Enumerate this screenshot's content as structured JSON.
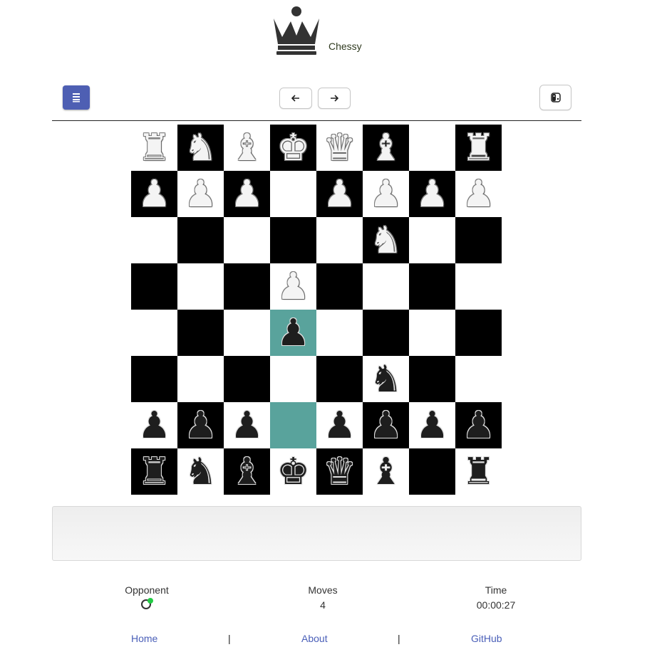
{
  "header": {
    "app_name": "Chessy",
    "logo_icon": "black-queen-icon"
  },
  "toolbar": {
    "menu_icon": "list-icon",
    "prev_icon": "arrow-left-icon",
    "next_icon": "arrow-right-icon",
    "flip_icon": "flip-board-icon",
    "accent_color": "#4e5fb3"
  },
  "board": {
    "light_color": "#ffffff",
    "dark_color": "#000000",
    "highlight_color": "#59a39c",
    "rows": [
      [
        "wR",
        "wN",
        "wB",
        "wK",
        "wQ",
        "wB",
        "",
        "wR"
      ],
      [
        "wP",
        "wP",
        "wP",
        "",
        "wP",
        "wP",
        "wP",
        "wP"
      ],
      [
        "",
        "",
        "",
        "",
        "",
        "wN",
        "",
        ""
      ],
      [
        "",
        "",
        "",
        "wP",
        "",
        "",
        "",
        ""
      ],
      [
        "",
        "",
        "",
        "bP",
        "",
        "",
        "",
        ""
      ],
      [
        "",
        "",
        "",
        "",
        "",
        "bN",
        "",
        ""
      ],
      [
        "bP",
        "bP",
        "bP",
        "",
        "bP",
        "bP",
        "bP",
        "bP"
      ],
      [
        "bR",
        "bN",
        "bB",
        "bK",
        "bQ",
        "bB",
        "",
        "bR"
      ]
    ],
    "last_move": [
      [
        4,
        3
      ],
      [
        6,
        3
      ]
    ]
  },
  "status": {
    "message": ""
  },
  "stats": {
    "opponent_label": "Opponent",
    "opponent_status_color": "#22cc44",
    "moves_label": "Moves",
    "moves_value": "4",
    "time_label": "Time",
    "time_value": "00:00:27"
  },
  "footer": {
    "home": "Home",
    "about": "About",
    "github": "GitHub",
    "separator": "|"
  }
}
